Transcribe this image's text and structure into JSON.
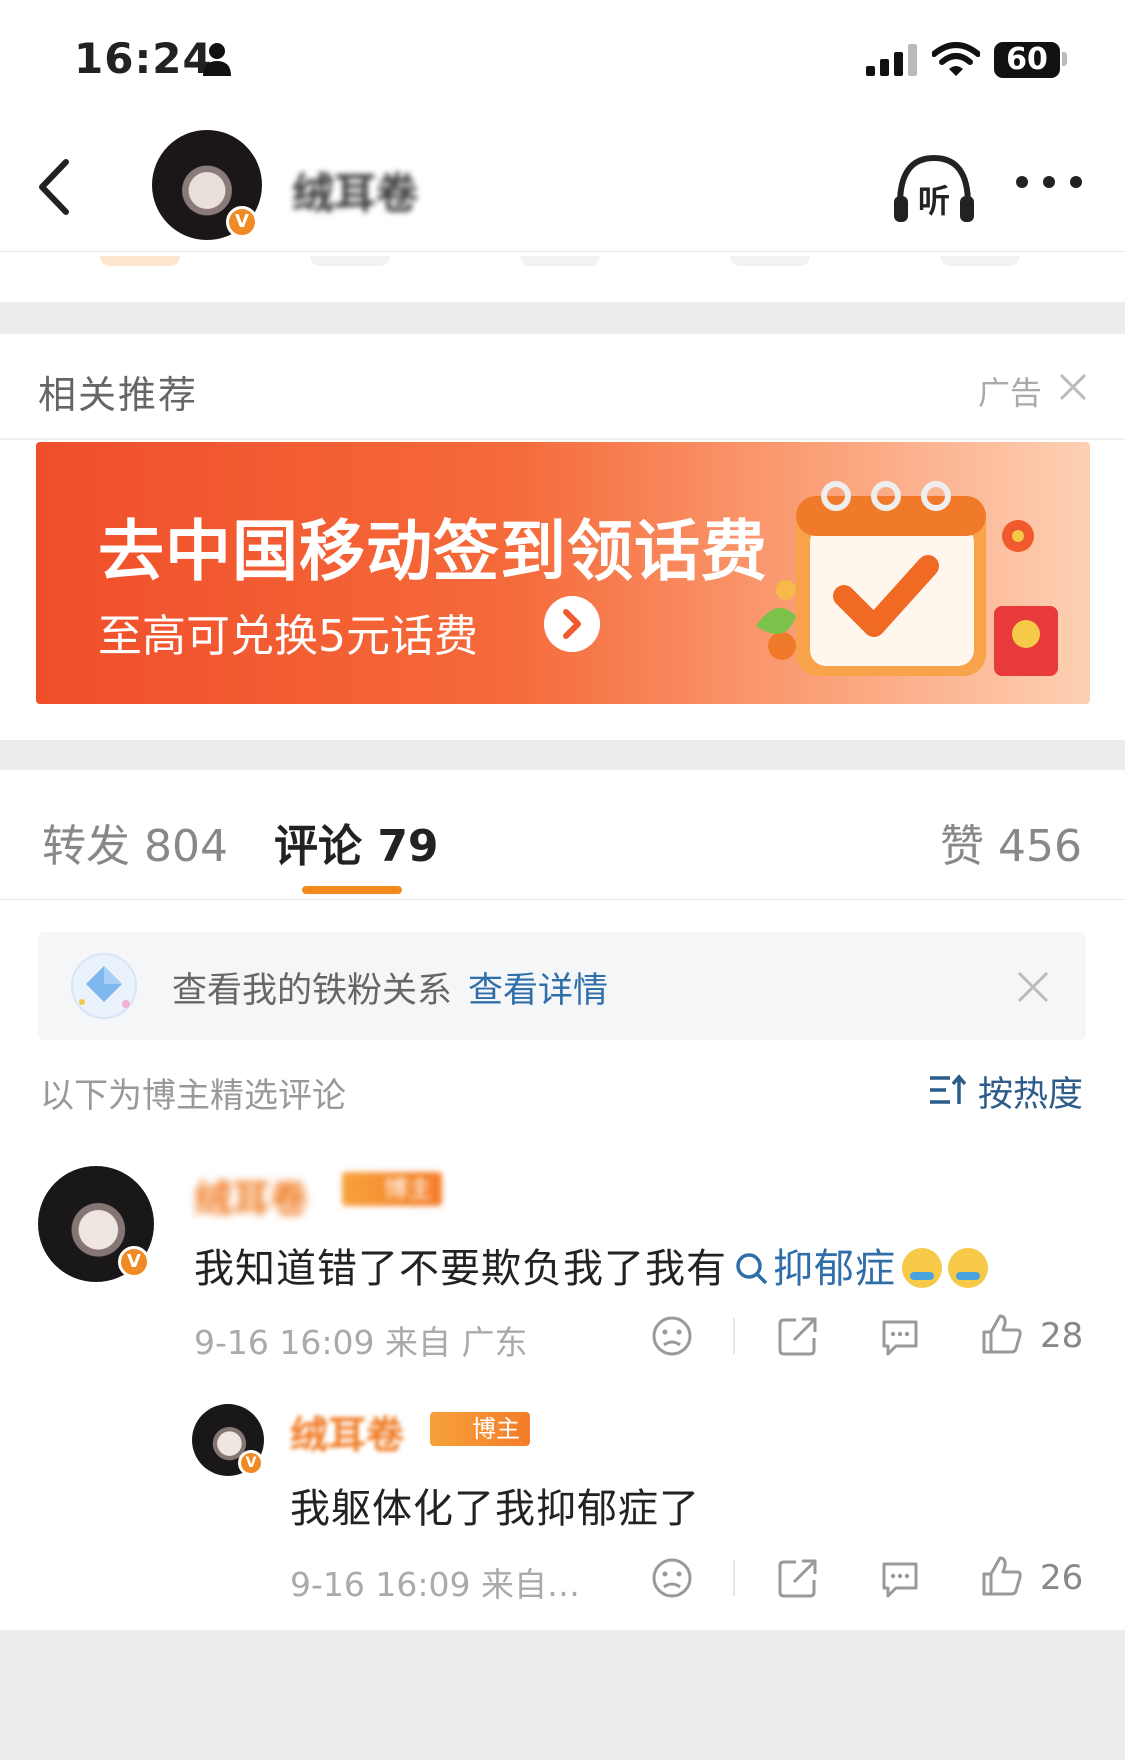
{
  "status_bar": {
    "time": "16:24",
    "battery": "60"
  },
  "header": {
    "account_name": "绒耳卷",
    "listen_label": "听"
  },
  "recommend": {
    "title": "相关推荐",
    "ad_label": "广告",
    "ad_headline": "去中国移动签到领话费",
    "ad_sub": "至高可兑换5元话费"
  },
  "tabs": [
    {
      "label": "转发 804"
    },
    {
      "label": "评论 79"
    },
    {
      "label": "赞 456"
    }
  ],
  "fans": {
    "text": "查看我的铁粉关系",
    "link": "查看详情"
  },
  "comments_header": {
    "label": "以下为博主精选评论",
    "sort_label": "按热度"
  },
  "comments": [
    {
      "author": "绒耳卷",
      "badge": "博主",
      "text": "我知道错了不要欺负我了我有",
      "topic": "抑郁症",
      "meta": "9-16 16:09 来自 广东",
      "likes": "28"
    },
    {
      "author": "绒耳卷",
      "badge": "博主",
      "text": "我躯体化了我抑郁症了",
      "meta": "9-16 16:09 来自…",
      "likes": "26"
    }
  ],
  "colors": {
    "accent": "#f48a1e",
    "link": "#2f6ea8",
    "ad_start": "#f04e2a"
  }
}
